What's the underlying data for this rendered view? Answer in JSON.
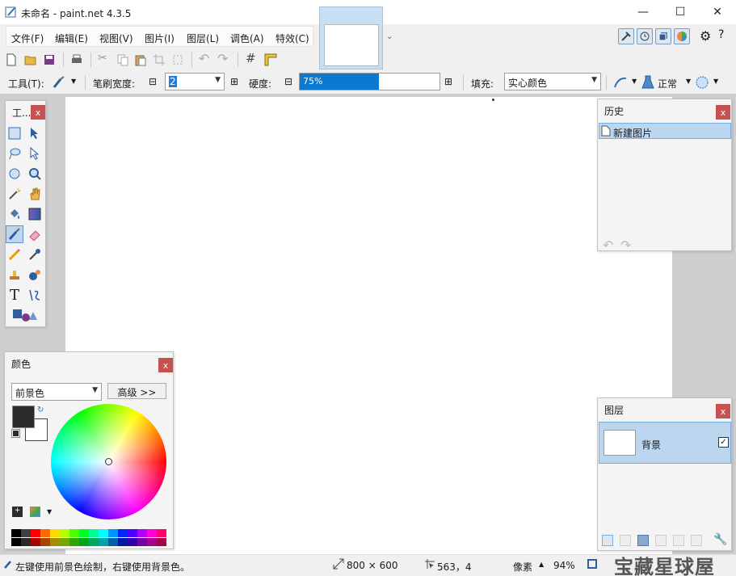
{
  "window": {
    "title": "未命名 - paint.net 4.3.5",
    "minimize": "—",
    "maximize": "☐",
    "close": "✕"
  },
  "menu": {
    "items": [
      "文件(F)",
      "编辑(E)",
      "视图(V)",
      "图片(I)",
      "图层(L)",
      "调色(A)",
      "特效(C)"
    ]
  },
  "toolbar": {
    "tool_label": "工具(T):",
    "brush_width_label": "笔刷宽度:",
    "brush_width_value": "2",
    "hardness_label": "硬度:",
    "hardness_value": "75%",
    "hardness_percent": 75,
    "fill_label": "填充:",
    "fill_value": "实心颜色",
    "blend_value": "正常",
    "minus": "⊟",
    "plus": "⊞"
  },
  "tools_panel": {
    "title": "工...",
    "close": "x"
  },
  "history_panel": {
    "title": "历史",
    "close": "x",
    "items": [
      "新建图片"
    ]
  },
  "colors_panel": {
    "title": "颜色",
    "close": "x",
    "mode": "前景色",
    "advanced": "高级 >>",
    "primary_color": "#2b2b2b",
    "secondary_color": "#ffffff"
  },
  "layers_panel": {
    "title": "图层",
    "close": "x",
    "layers": [
      {
        "name": "背景",
        "visible": true
      }
    ]
  },
  "status": {
    "hint": "左键使用前景色绘制，右键使用背景色。",
    "size": "800 × 600",
    "position": "563，4",
    "unit": "像素",
    "zoom": "94%"
  },
  "watermark": "宝藏星球屋",
  "palette": [
    "#000000",
    "#404040",
    "#ff0000",
    "#ff6a00",
    "#ffd800",
    "#b6ff00",
    "#4cff00",
    "#00ff21",
    "#00ff90",
    "#00ffff",
    "#0094ff",
    "#0026ff",
    "#4800ff",
    "#b200ff",
    "#ff00dc",
    "#ff006e"
  ]
}
